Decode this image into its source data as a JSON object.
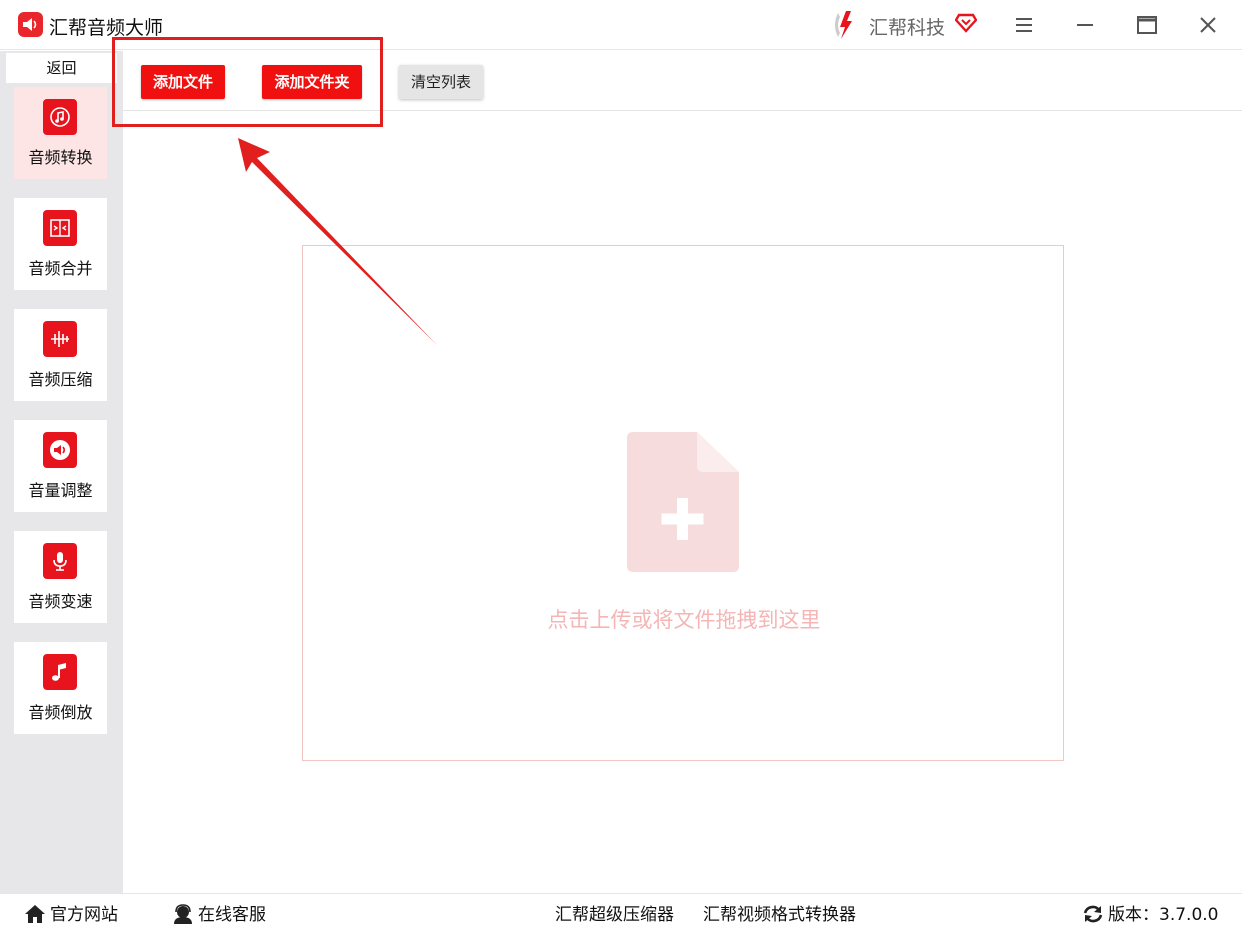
{
  "app": {
    "title": "汇帮音频大师",
    "brand_name": "汇帮科技",
    "accent": "#e8141d"
  },
  "window_controls": [
    "menu-icon",
    "minimize-icon",
    "maximize-icon",
    "close-icon"
  ],
  "sidebar": {
    "back_label": "返回",
    "items": [
      {
        "label": "音频转换",
        "icon": "audio-convert-icon",
        "active": true
      },
      {
        "label": "音频合并",
        "icon": "audio-merge-icon",
        "active": false
      },
      {
        "label": "音频压缩",
        "icon": "audio-compress-icon",
        "active": false
      },
      {
        "label": "音量调整",
        "icon": "volume-adjust-icon",
        "active": false
      },
      {
        "label": "音频变速",
        "icon": "audio-speed-icon",
        "active": false
      },
      {
        "label": "音频倒放",
        "icon": "audio-reverse-icon",
        "active": false
      }
    ]
  },
  "toolbar": {
    "add_file": "添加文件",
    "add_folder": "添加文件夹",
    "clear_list": "清空列表"
  },
  "dropzone": {
    "hint": "点击上传或将文件拖拽到这里",
    "icon": "file-add-icon"
  },
  "footer": {
    "official_site": "官方网站",
    "online_service": "在线客服",
    "super_compressor": "汇帮超级压缩器",
    "video_converter": "汇帮视频格式转换器",
    "version": "版本：3.7.0.0"
  }
}
